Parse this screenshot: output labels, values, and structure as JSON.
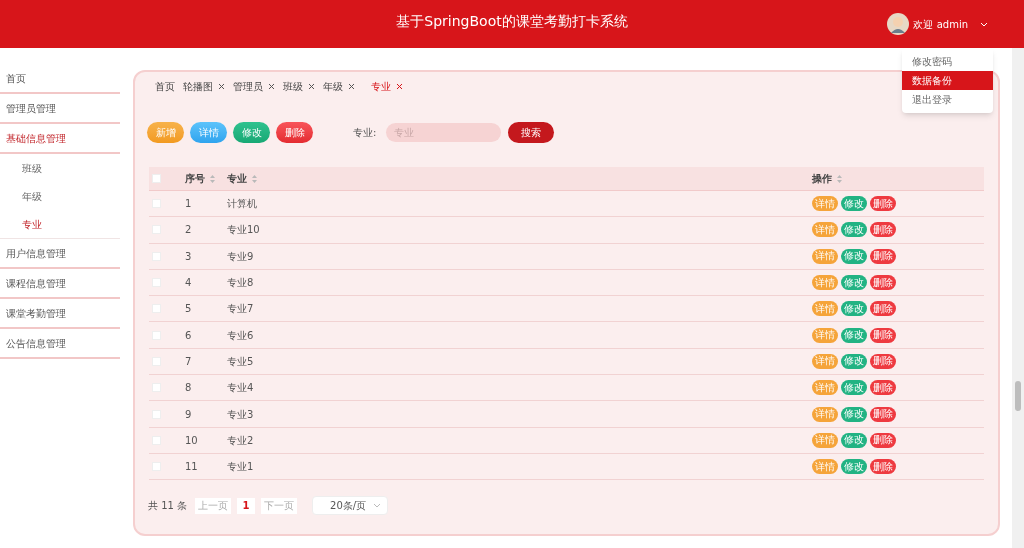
{
  "header": {
    "title": "基于SpringBoot的课堂考勤打卡系统",
    "user": "欢迎 admin"
  },
  "user_menu": [
    {
      "label": "修改密码",
      "selected": false
    },
    {
      "label": "数据备份",
      "selected": true
    },
    {
      "label": "退出登录",
      "selected": false
    }
  ],
  "sidebar": {
    "items": [
      {
        "label": "首页",
        "selected": false
      },
      {
        "label": "管理员管理",
        "selected": false
      },
      {
        "label": "基础信息管理",
        "selected": true,
        "expanded": true,
        "children": [
          {
            "label": "班级",
            "selected": false
          },
          {
            "label": "年级",
            "selected": false
          },
          {
            "label": "专业",
            "selected": true
          }
        ]
      },
      {
        "label": "用户信息管理",
        "selected": false
      },
      {
        "label": "课程信息管理",
        "selected": false
      },
      {
        "label": "课堂考勤管理",
        "selected": false
      },
      {
        "label": "公告信息管理",
        "selected": false
      }
    ]
  },
  "tabs": [
    {
      "label": "首页",
      "selected": false,
      "closable": false
    },
    {
      "label": "轮播图",
      "selected": false,
      "closable": true
    },
    {
      "label": "管理员",
      "selected": false,
      "closable": true
    },
    {
      "label": "班级",
      "selected": false,
      "closable": true
    },
    {
      "label": "年级",
      "selected": false,
      "closable": true
    },
    {
      "label": "专业",
      "selected": true,
      "closable": true
    }
  ],
  "toolbar": {
    "buttons": [
      {
        "label": "新增",
        "kind": "add"
      },
      {
        "label": "详情",
        "kind": "detail"
      },
      {
        "label": "修改",
        "kind": "edit"
      },
      {
        "label": "删除",
        "kind": "delete"
      }
    ],
    "search_label": "专业:",
    "search_placeholder": "专业",
    "search_button": "搜索"
  },
  "table": {
    "columns": [
      "序号",
      "专业",
      "操作"
    ],
    "header_checked": false,
    "rows": [
      {
        "index": "1",
        "name": "计算机",
        "checked": false,
        "actions": [
          {
            "label": "详情",
            "kind": "detail"
          },
          {
            "label": "修改",
            "kind": "edit"
          },
          {
            "label": "删除",
            "kind": "delete"
          }
        ]
      },
      {
        "index": "2",
        "name": "专业10",
        "checked": false,
        "actions": [
          {
            "label": "详情",
            "kind": "detail"
          },
          {
            "label": "修改",
            "kind": "edit"
          },
          {
            "label": "删除",
            "kind": "delete"
          }
        ]
      },
      {
        "index": "3",
        "name": "专业9",
        "checked": false,
        "actions": [
          {
            "label": "详情",
            "kind": "detail"
          },
          {
            "label": "修改",
            "kind": "edit"
          },
          {
            "label": "删除",
            "kind": "delete"
          }
        ]
      },
      {
        "index": "4",
        "name": "专业8",
        "checked": false,
        "actions": [
          {
            "label": "详情",
            "kind": "detail"
          },
          {
            "label": "修改",
            "kind": "edit"
          },
          {
            "label": "删除",
            "kind": "delete"
          }
        ]
      },
      {
        "index": "5",
        "name": "专业7",
        "checked": false,
        "actions": [
          {
            "label": "详情",
            "kind": "detail"
          },
          {
            "label": "修改",
            "kind": "edit"
          },
          {
            "label": "删除",
            "kind": "delete"
          }
        ]
      },
      {
        "index": "6",
        "name": "专业6",
        "checked": false,
        "actions": [
          {
            "label": "详情",
            "kind": "detail"
          },
          {
            "label": "修改",
            "kind": "edit"
          },
          {
            "label": "删除",
            "kind": "delete"
          }
        ]
      },
      {
        "index": "7",
        "name": "专业5",
        "checked": false,
        "actions": [
          {
            "label": "详情",
            "kind": "detail"
          },
          {
            "label": "修改",
            "kind": "edit"
          },
          {
            "label": "删除",
            "kind": "delete"
          }
        ]
      },
      {
        "index": "8",
        "name": "专业4",
        "checked": false,
        "actions": [
          {
            "label": "详情",
            "kind": "detail"
          },
          {
            "label": "修改",
            "kind": "edit"
          },
          {
            "label": "删除",
            "kind": "delete"
          }
        ]
      },
      {
        "index": "9",
        "name": "专业3",
        "checked": false,
        "actions": [
          {
            "label": "详情",
            "kind": "detail"
          },
          {
            "label": "修改",
            "kind": "edit"
          },
          {
            "label": "删除",
            "kind": "delete"
          }
        ]
      },
      {
        "index": "10",
        "name": "专业2",
        "checked": false,
        "actions": [
          {
            "label": "详情",
            "kind": "detail"
          },
          {
            "label": "修改",
            "kind": "edit"
          },
          {
            "label": "删除",
            "kind": "delete"
          }
        ]
      },
      {
        "index": "11",
        "name": "专业1",
        "checked": false,
        "actions": [
          {
            "label": "详情",
            "kind": "detail"
          },
          {
            "label": "修改",
            "kind": "edit"
          },
          {
            "label": "删除",
            "kind": "delete"
          }
        ]
      }
    ]
  },
  "pagination": {
    "total": "共 11 条",
    "prev": "上一页",
    "pages": [
      {
        "label": "1",
        "selected": true
      }
    ],
    "next": "下一页",
    "page_size": "20条/页"
  }
}
